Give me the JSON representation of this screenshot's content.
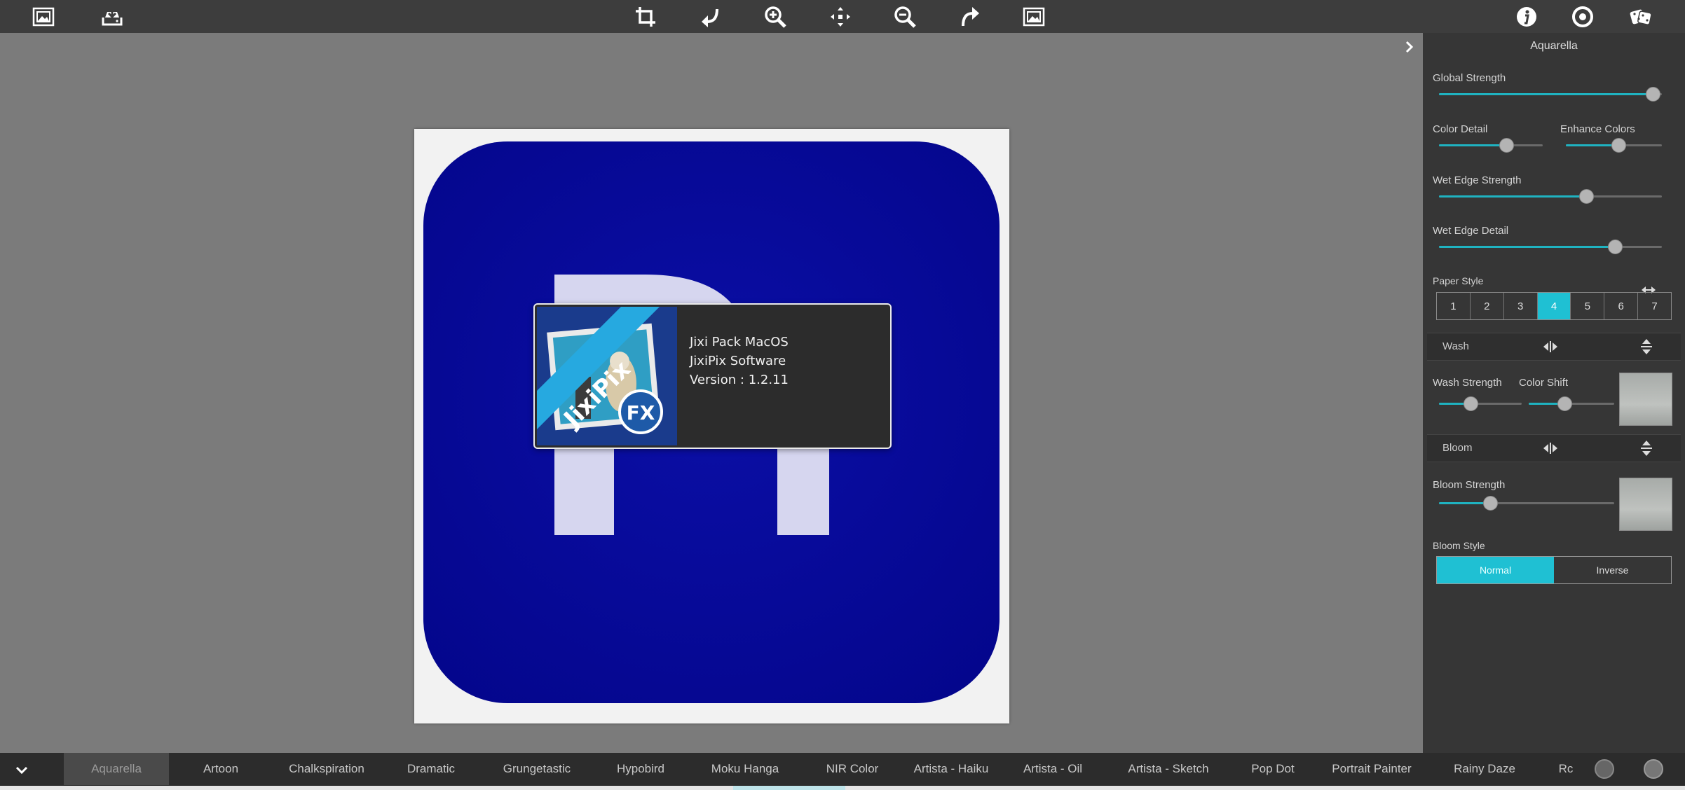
{
  "toolbar": {
    "left_icons": [
      "open-image-icon",
      "save-icon"
    ],
    "center_icons": [
      "crop-icon",
      "undo-icon",
      "zoom-in-icon",
      "pan-icon",
      "zoom-out-icon",
      "redo-icon",
      "fit-image-icon"
    ],
    "right_icons": [
      "info-icon",
      "settings-icon",
      "random-dice-icon"
    ]
  },
  "about": {
    "logo_text": "JixiPix",
    "logo_badge": "FX",
    "line1": "Jixi Pack MacOS",
    "line2": "JixiPix Software",
    "line3": "Version : 1.2.11"
  },
  "panel": {
    "title": "Aquarella",
    "global_strength": {
      "label": "Global Strength",
      "value": 0.96
    },
    "color_detail": {
      "label": "Color Detail",
      "value": 0.65
    },
    "enhance_colors": {
      "label": "Enhance Colors",
      "value": 0.55
    },
    "wet_edge_strength": {
      "label": "Wet Edge Strength",
      "value": 0.66
    },
    "wet_edge_detail": {
      "label": "Wet Edge Detail",
      "value": 0.79
    },
    "paper_style": {
      "label": "Paper Style",
      "options": [
        "1",
        "2",
        "3",
        "4",
        "5",
        "6",
        "7"
      ],
      "selected": "4"
    },
    "wash": {
      "label": "Wash"
    },
    "wash_strength": {
      "label": "Wash Strength",
      "value": 0.38
    },
    "color_shift": {
      "label": "Color Shift",
      "value": 0.42
    },
    "bloom": {
      "label": "Bloom"
    },
    "bloom_strength": {
      "label": "Bloom Strength",
      "value": 0.29
    },
    "bloom_style": {
      "label": "Bloom Style",
      "options": [
        "Normal",
        "Inverse"
      ],
      "selected": "Normal"
    }
  },
  "filters": {
    "tabs": [
      "Aquarella",
      "Artoon",
      "Chalkspiration",
      "Dramatic",
      "Grungetastic",
      "Hypobird",
      "Moku Hanga",
      "NIR Color",
      "Artista - Haiku",
      "Artista - Oil",
      "Artista - Sketch",
      "Pop Dot",
      "Portrait Painter",
      "Rainy Daze",
      "Rc"
    ],
    "active": "Aquarella"
  },
  "colors": {
    "accent": "#1fc0d3",
    "icon_blue": "#0a0a9e",
    "toolbar_bg": "#3d3d3d",
    "canvas_bg": "#7b7b7b"
  }
}
